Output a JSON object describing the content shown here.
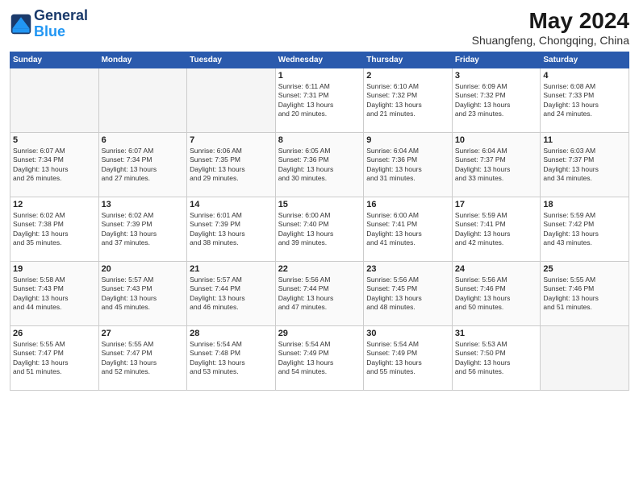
{
  "header": {
    "logo_line1": "General",
    "logo_line2": "Blue",
    "main_title": "May 2024",
    "subtitle": "Shuangfeng, Chongqing, China"
  },
  "weekdays": [
    "Sunday",
    "Monday",
    "Tuesday",
    "Wednesday",
    "Thursday",
    "Friday",
    "Saturday"
  ],
  "weeks": [
    [
      {
        "day": "",
        "info": ""
      },
      {
        "day": "",
        "info": ""
      },
      {
        "day": "",
        "info": ""
      },
      {
        "day": "1",
        "info": "Sunrise: 6:11 AM\nSunset: 7:31 PM\nDaylight: 13 hours\nand 20 minutes."
      },
      {
        "day": "2",
        "info": "Sunrise: 6:10 AM\nSunset: 7:32 PM\nDaylight: 13 hours\nand 21 minutes."
      },
      {
        "day": "3",
        "info": "Sunrise: 6:09 AM\nSunset: 7:32 PM\nDaylight: 13 hours\nand 23 minutes."
      },
      {
        "day": "4",
        "info": "Sunrise: 6:08 AM\nSunset: 7:33 PM\nDaylight: 13 hours\nand 24 minutes."
      }
    ],
    [
      {
        "day": "5",
        "info": "Sunrise: 6:07 AM\nSunset: 7:34 PM\nDaylight: 13 hours\nand 26 minutes."
      },
      {
        "day": "6",
        "info": "Sunrise: 6:07 AM\nSunset: 7:34 PM\nDaylight: 13 hours\nand 27 minutes."
      },
      {
        "day": "7",
        "info": "Sunrise: 6:06 AM\nSunset: 7:35 PM\nDaylight: 13 hours\nand 29 minutes."
      },
      {
        "day": "8",
        "info": "Sunrise: 6:05 AM\nSunset: 7:36 PM\nDaylight: 13 hours\nand 30 minutes."
      },
      {
        "day": "9",
        "info": "Sunrise: 6:04 AM\nSunset: 7:36 PM\nDaylight: 13 hours\nand 31 minutes."
      },
      {
        "day": "10",
        "info": "Sunrise: 6:04 AM\nSunset: 7:37 PM\nDaylight: 13 hours\nand 33 minutes."
      },
      {
        "day": "11",
        "info": "Sunrise: 6:03 AM\nSunset: 7:37 PM\nDaylight: 13 hours\nand 34 minutes."
      }
    ],
    [
      {
        "day": "12",
        "info": "Sunrise: 6:02 AM\nSunset: 7:38 PM\nDaylight: 13 hours\nand 35 minutes."
      },
      {
        "day": "13",
        "info": "Sunrise: 6:02 AM\nSunset: 7:39 PM\nDaylight: 13 hours\nand 37 minutes."
      },
      {
        "day": "14",
        "info": "Sunrise: 6:01 AM\nSunset: 7:39 PM\nDaylight: 13 hours\nand 38 minutes."
      },
      {
        "day": "15",
        "info": "Sunrise: 6:00 AM\nSunset: 7:40 PM\nDaylight: 13 hours\nand 39 minutes."
      },
      {
        "day": "16",
        "info": "Sunrise: 6:00 AM\nSunset: 7:41 PM\nDaylight: 13 hours\nand 41 minutes."
      },
      {
        "day": "17",
        "info": "Sunrise: 5:59 AM\nSunset: 7:41 PM\nDaylight: 13 hours\nand 42 minutes."
      },
      {
        "day": "18",
        "info": "Sunrise: 5:59 AM\nSunset: 7:42 PM\nDaylight: 13 hours\nand 43 minutes."
      }
    ],
    [
      {
        "day": "19",
        "info": "Sunrise: 5:58 AM\nSunset: 7:43 PM\nDaylight: 13 hours\nand 44 minutes."
      },
      {
        "day": "20",
        "info": "Sunrise: 5:57 AM\nSunset: 7:43 PM\nDaylight: 13 hours\nand 45 minutes."
      },
      {
        "day": "21",
        "info": "Sunrise: 5:57 AM\nSunset: 7:44 PM\nDaylight: 13 hours\nand 46 minutes."
      },
      {
        "day": "22",
        "info": "Sunrise: 5:56 AM\nSunset: 7:44 PM\nDaylight: 13 hours\nand 47 minutes."
      },
      {
        "day": "23",
        "info": "Sunrise: 5:56 AM\nSunset: 7:45 PM\nDaylight: 13 hours\nand 48 minutes."
      },
      {
        "day": "24",
        "info": "Sunrise: 5:56 AM\nSunset: 7:46 PM\nDaylight: 13 hours\nand 50 minutes."
      },
      {
        "day": "25",
        "info": "Sunrise: 5:55 AM\nSunset: 7:46 PM\nDaylight: 13 hours\nand 51 minutes."
      }
    ],
    [
      {
        "day": "26",
        "info": "Sunrise: 5:55 AM\nSunset: 7:47 PM\nDaylight: 13 hours\nand 51 minutes."
      },
      {
        "day": "27",
        "info": "Sunrise: 5:55 AM\nSunset: 7:47 PM\nDaylight: 13 hours\nand 52 minutes."
      },
      {
        "day": "28",
        "info": "Sunrise: 5:54 AM\nSunset: 7:48 PM\nDaylight: 13 hours\nand 53 minutes."
      },
      {
        "day": "29",
        "info": "Sunrise: 5:54 AM\nSunset: 7:49 PM\nDaylight: 13 hours\nand 54 minutes."
      },
      {
        "day": "30",
        "info": "Sunrise: 5:54 AM\nSunset: 7:49 PM\nDaylight: 13 hours\nand 55 minutes."
      },
      {
        "day": "31",
        "info": "Sunrise: 5:53 AM\nSunset: 7:50 PM\nDaylight: 13 hours\nand 56 minutes."
      },
      {
        "day": "",
        "info": ""
      }
    ]
  ]
}
